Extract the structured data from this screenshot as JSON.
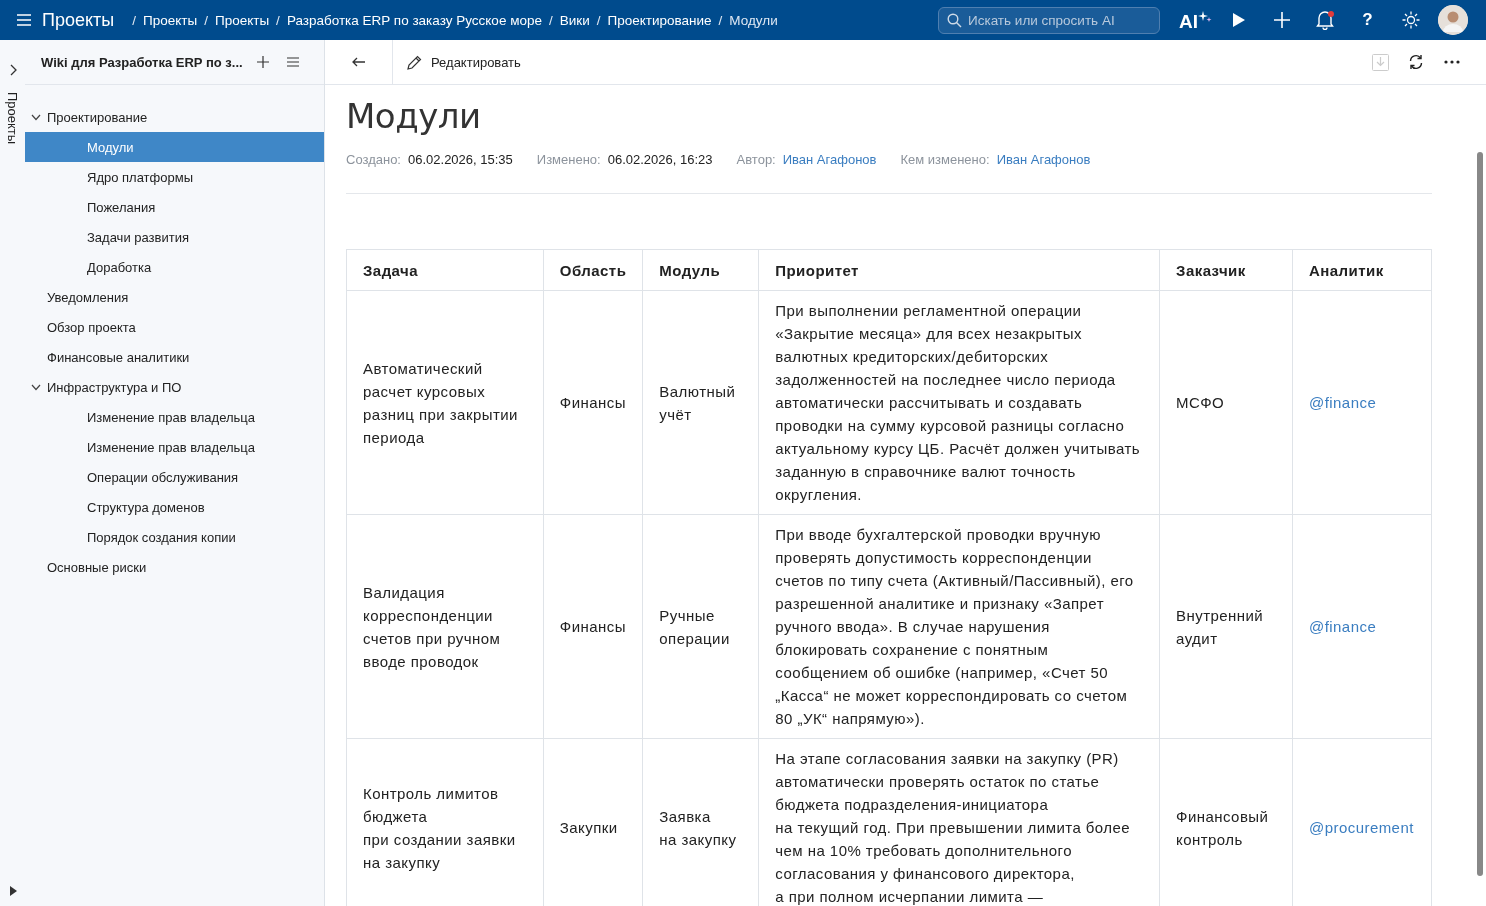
{
  "topbar": {
    "app_title": "Проекты",
    "breadcrumb": {
      "separator": "/",
      "items": [
        "Проекты",
        "Проекты",
        "Разработка ERP по заказу Русское море",
        "Вики",
        "Проектирование",
        "Модули"
      ]
    },
    "search": {
      "placeholder": "Искать или спросить AI"
    },
    "ai_label": "AI",
    "help": "?",
    "notification_badge": true
  },
  "sidebar": {
    "rail_label": "Проекты",
    "title": "Wiki для Разработка ERP по з...",
    "tree": [
      {
        "label": "Проектирование",
        "expanded": true,
        "selected": false,
        "children": [
          {
            "label": "Модули",
            "selected": true
          },
          {
            "label": "Ядро платформы",
            "selected": false
          },
          {
            "label": "Пожелания",
            "selected": false
          },
          {
            "label": "Задачи развития",
            "selected": false
          },
          {
            "label": "Доработка",
            "selected": false
          }
        ]
      },
      {
        "label": "Уведомления",
        "selected": false
      },
      {
        "label": "Обзор проекта",
        "selected": false
      },
      {
        "label": "Финансовые аналитики",
        "selected": false
      },
      {
        "label": "Инфраструктура и ПО",
        "expanded": true,
        "selected": false,
        "children": [
          {
            "label": "Изменение прав владельца",
            "selected": false
          },
          {
            "label": "Изменение прав владельца",
            "selected": false
          },
          {
            "label": "Операции обслуживания",
            "selected": false
          },
          {
            "label": "Структура доменов",
            "selected": false
          },
          {
            "label": "Порядок создания копии",
            "selected": false
          }
        ]
      },
      {
        "label": "Основные риски",
        "selected": false
      }
    ]
  },
  "toolbar": {
    "edit_label": "Редактировать"
  },
  "page": {
    "title": "Модули",
    "meta": [
      {
        "label": "Создано:",
        "value": "06.02.2026, 15:35",
        "kind": "text"
      },
      {
        "label": "Изменено:",
        "value": "06.02.2026, 16:23",
        "kind": "text"
      },
      {
        "label": "Автор:",
        "value": "Иван Агафонов",
        "kind": "link"
      },
      {
        "label": "Кем изменено:",
        "value": "Иван Агафонов",
        "kind": "link"
      }
    ]
  },
  "table": {
    "columns": [
      "Задача",
      "Область",
      "Модуль",
      "Приоритет",
      "Заказчик",
      "Аналитик"
    ],
    "rows": [
      [
        "Автоматический расчет курсовых разниц при закрытии периода",
        "Финансы",
        "Валютный учёт",
        "При выполнении регламентной операции «Закрытие месяца» для всех незакрытых валютных кредиторских/дебиторских задолженностей на последнее число периода автоматически рассчитывать и создавать проводки на сумму курсовой разницы согласно актуальному курсу ЦБ. Расчёт должен учитывать заданную в справочнике валют точность округления.",
        "МСФО",
        "@finance"
      ],
      [
        "Валидация корреспонденции счетов при ручном вводе проводок",
        "Финансы",
        "Ручные операции",
        "При вводе бухгалтерской проводки вручную проверять допустимость корреспонденции счетов по типу счета (Активный/Пассивный), его разрешенной аналитике и признаку «Запрет ручного ввода». В случае нарушения блокировать сохранение с понятным сообщением об ошибке (например, «Счет 50 „Касса“ не может корреспондировать со счетом 80 „УК“ напрямую»).",
        "Внутренний аудит",
        "@finance"
      ],
      [
        "Контроль лимитов бюджета\nпри создании заявки на закупку",
        "Закупки",
        "Заявка\nна закупку",
        "На этапе согласования заявки на закупку (PR) автоматически проверять остаток по статье бюджета подразделения-инициатора\nна текущий год. При превышении лимита более чем на 10% требовать дополнительного согласования у финансового директора,\nа при полном исчерпании лимита —",
        "Финансовый контроль",
        "@procurement"
      ]
    ]
  }
}
